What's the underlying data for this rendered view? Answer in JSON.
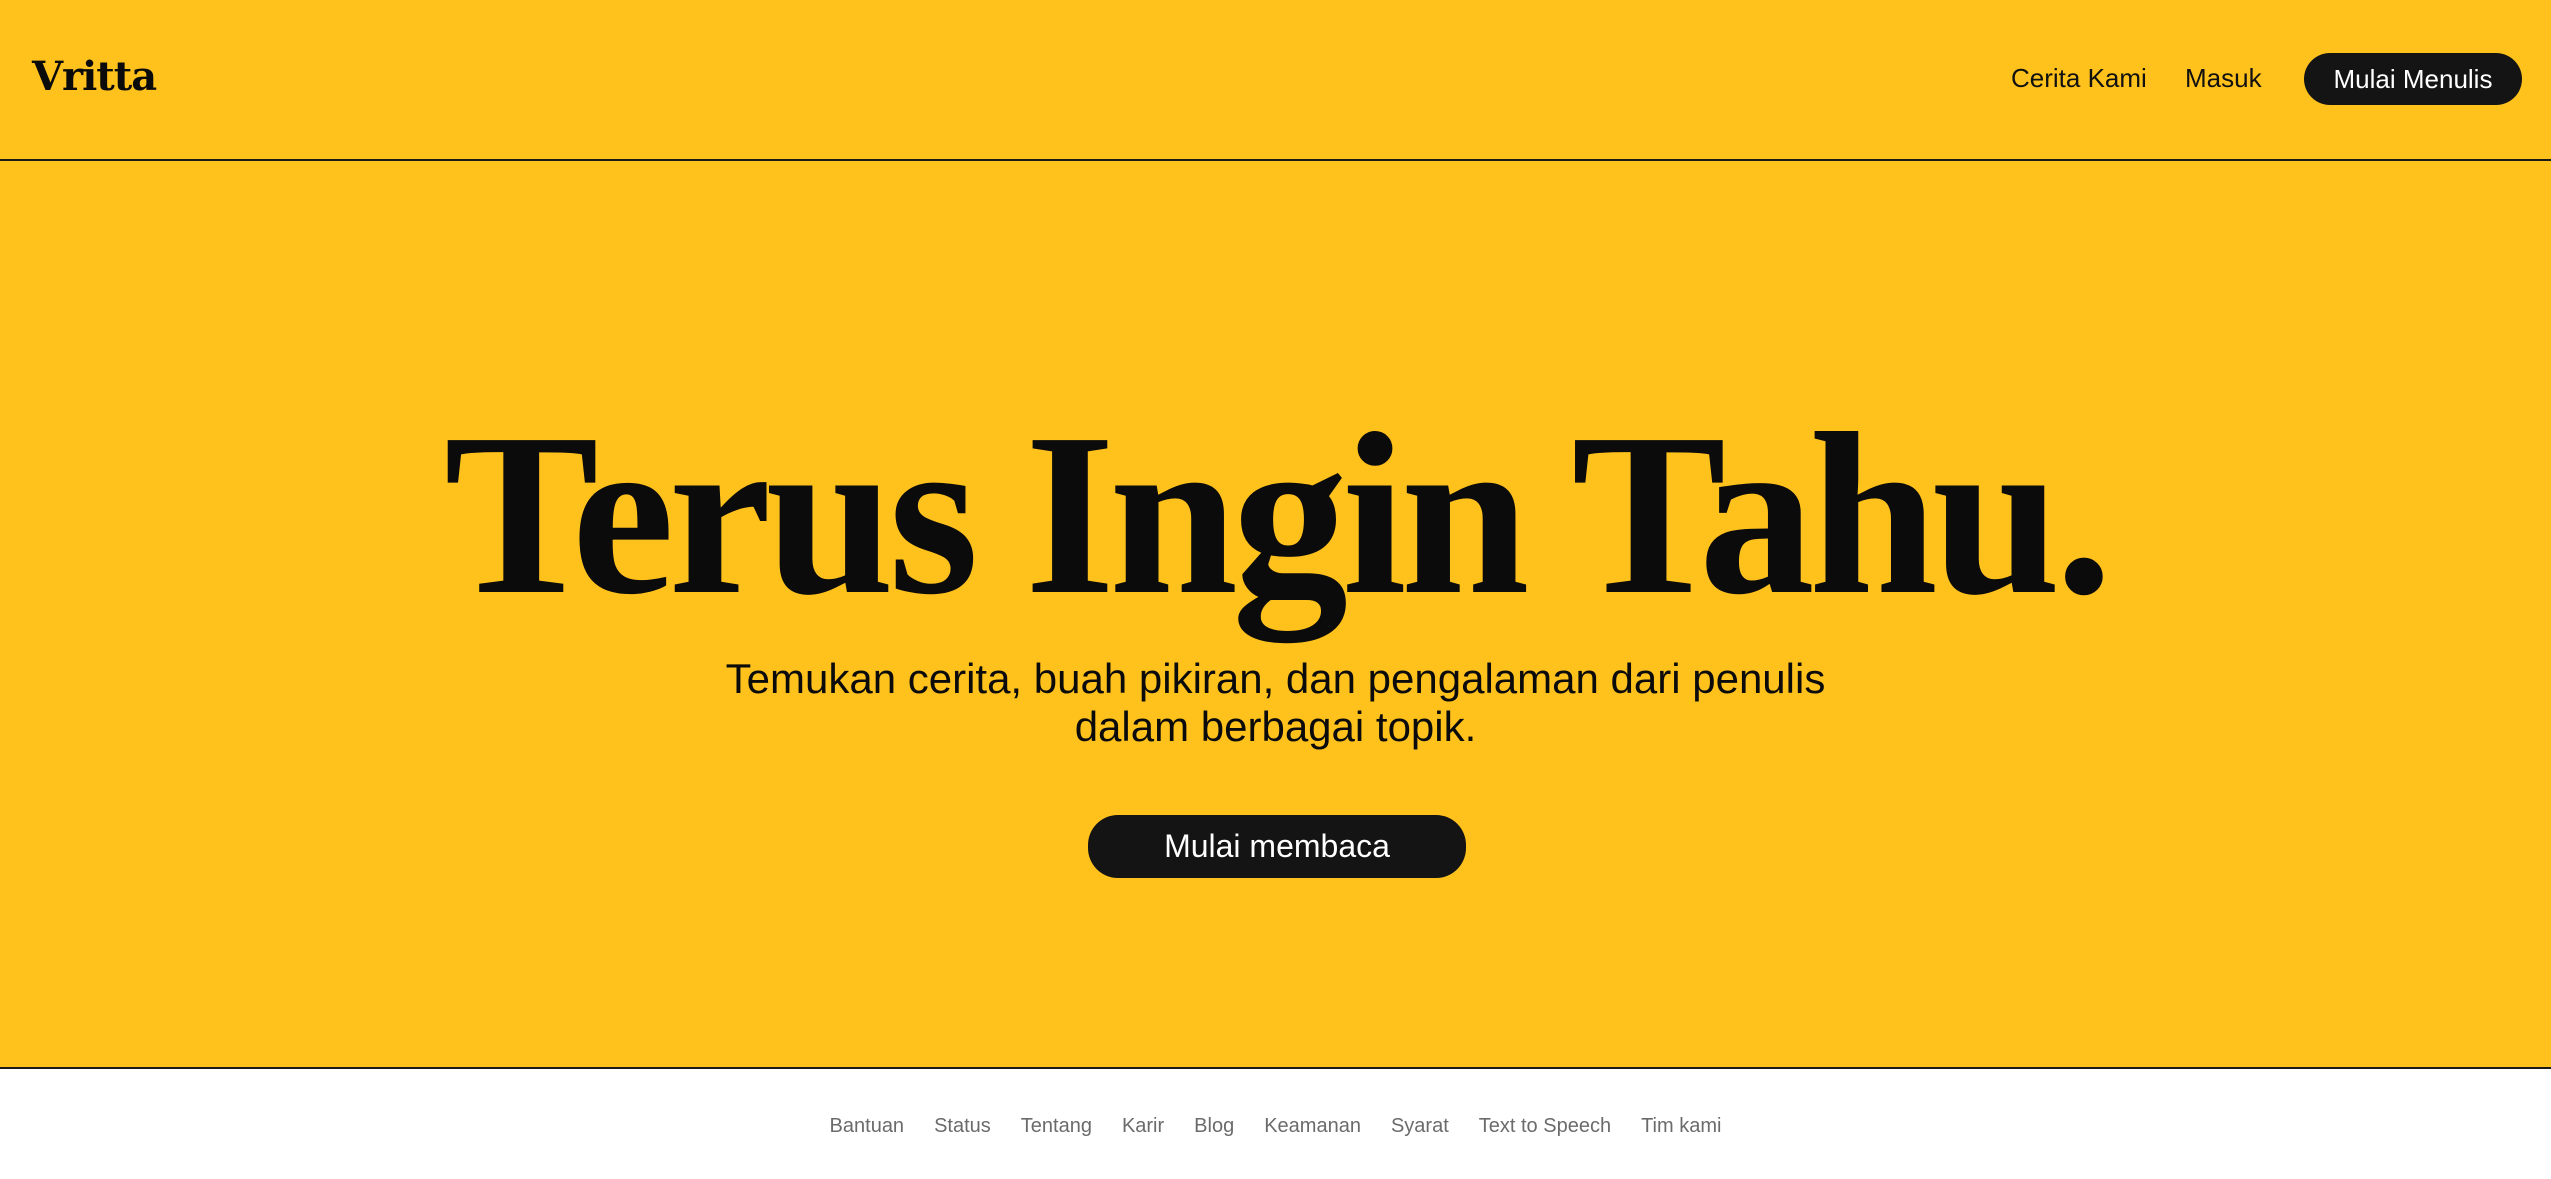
{
  "header": {
    "logo": "Vritta",
    "nav": {
      "our_story": "Cerita Kami",
      "login": "Masuk"
    },
    "cta_label": "Mulai Menulis"
  },
  "hero": {
    "title": "Terus Ingin Tahu.",
    "subtitle": "Temukan cerita, buah pikiran, dan pengalaman dari penulis dalam berbagai topik.",
    "cta_label": "Mulai membaca"
  },
  "footer": {
    "links": [
      "Bantuan",
      "Status",
      "Tentang",
      "Karir",
      "Blog",
      "Keamanan",
      "Syarat",
      "Text to Speech",
      "Tim kami"
    ]
  },
  "colors": {
    "background": "#ffc11c",
    "button": "#141414",
    "footer_background": "#ffffff",
    "footer_text": "#6b6b6b"
  }
}
